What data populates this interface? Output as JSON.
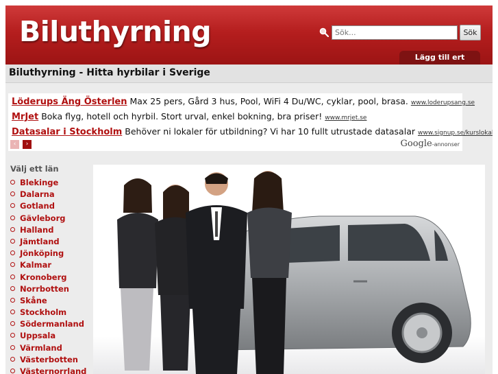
{
  "header": {
    "logo": "Biluthyrning",
    "search_placeholder": "Sök...",
    "search_button": "Sök",
    "add_company": "Lägg till ert företag"
  },
  "page": {
    "title": "Biluthyrning - Hitta hyrbilar i Sverige"
  },
  "ads": [
    {
      "title": "Löderups Äng Österlen",
      "text": "Max 25 pers, Gård 3 hus, Pool, WiFi 4 Du/WC, cyklar, pool, brasa.",
      "url": "www.loderupsang.se"
    },
    {
      "title": "MrJet",
      "text": "Boka flyg, hotell och hyrbil. Stort urval, enkel bokning, bra priser!",
      "url": "www.mrjet.se"
    },
    {
      "title": "Datasalar i Stockholm",
      "text": "Behöver ni lokaler för utbildning? Vi har 10 fullt utrustade datasalar",
      "url": "www.signup.se/kurslokaler"
    }
  ],
  "ad_nav": {
    "prev": "‹",
    "next": "›"
  },
  "google": {
    "brand": "Google",
    "suffix": "-annonser"
  },
  "sidebar": {
    "title": "Välj ett län",
    "items": [
      "Blekinge",
      "Dalarna",
      "Gotland",
      "Gävleborg",
      "Halland",
      "Jämtland",
      "Jönköping",
      "Kalmar",
      "Kronoberg",
      "Norrbotten",
      "Skåne",
      "Stockholm",
      "Södermanland",
      "Uppsala",
      "Värmland",
      "Västerbotten",
      "Västernorrland"
    ]
  },
  "colors": {
    "brand_red": "#b51e1e",
    "link_red": "#b01010",
    "dark_red": "#7e1212"
  },
  "icons": {
    "search": "search-icon"
  }
}
